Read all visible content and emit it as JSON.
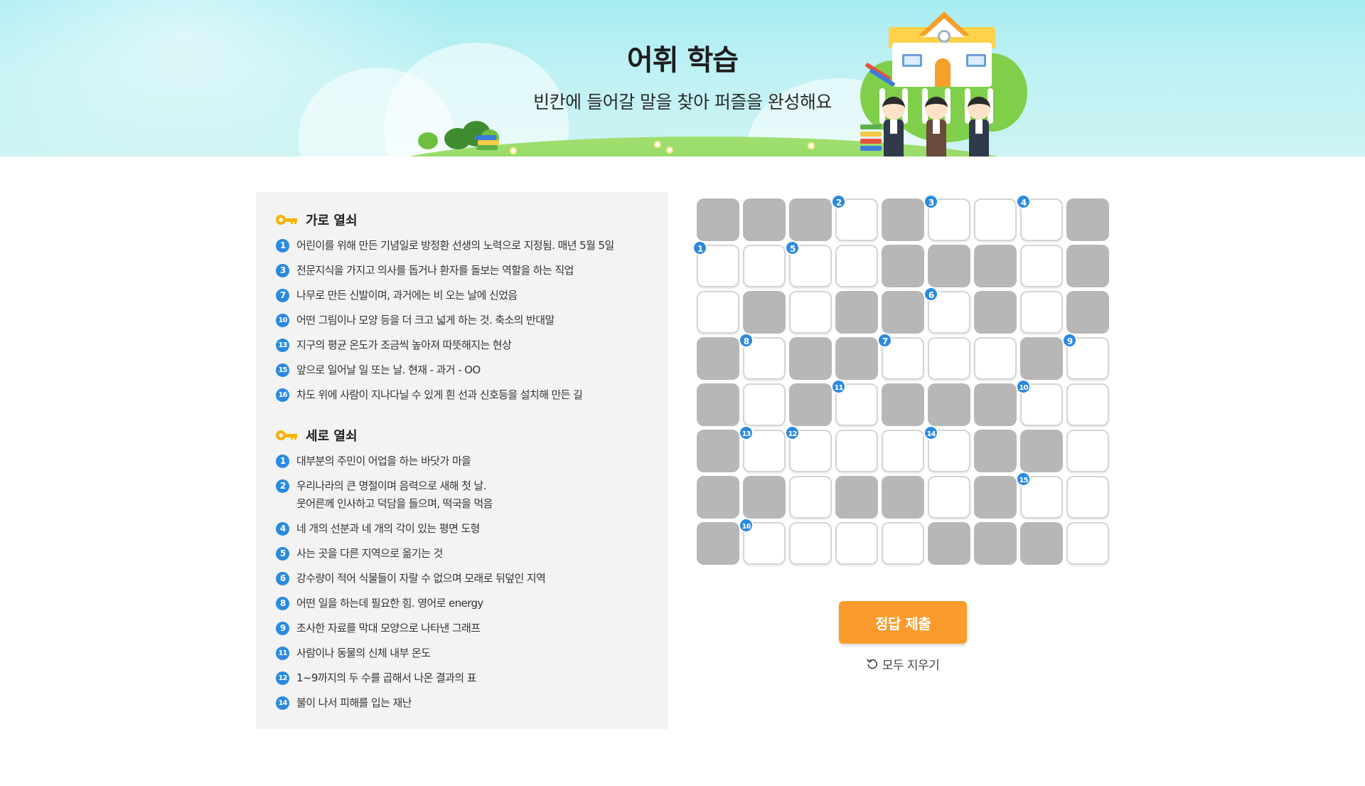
{
  "header": {
    "title": "어휘 학습",
    "subtitle": "빈칸에 들어갈 말을 찾아 퍼즐을 완성해요"
  },
  "clues": {
    "across": {
      "title": "가로 열쇠",
      "items": [
        {
          "num": "1",
          "text": "어린이를 위해 만든 기념일로 방정환 선생의 노력으로 지정됨. 매년 5월 5일"
        },
        {
          "num": "3",
          "text": "전문지식을 가지고 의사를 돕거나 환자를 돌보는 역할을 하는 직업"
        },
        {
          "num": "7",
          "text": "나무로 만든 신발이며, 과거에는 비 오는 날에 신었음"
        },
        {
          "num": "10",
          "text": "어떤 그림이나 모양 등을 더 크고 넓게 하는 것. 축소의 반대말"
        },
        {
          "num": "13",
          "text": "지구의 평균 온도가 조금씩 높아져 따뜻해지는 현상"
        },
        {
          "num": "15",
          "text": "앞으로 일어날 일 또는 날. 현재 - 과거 - OO"
        },
        {
          "num": "16",
          "text": "차도 위에 사람이 지나다닐 수 있게 흰 선과 신호등을 설치해 만든 길"
        }
      ]
    },
    "down": {
      "title": "세로 열쇠",
      "items": [
        {
          "num": "1",
          "text": "대부분의 주민이 어업을 하는 바닷가 마을"
        },
        {
          "num": "2",
          "text": "우리나라의 큰 명절이며 음력으로 새해 첫 날.\n웃어른께 인사하고 덕담을 들으며, 떡국을 먹음"
        },
        {
          "num": "4",
          "text": "네 개의 선분과 네 개의 각이 있는 평면 도형"
        },
        {
          "num": "5",
          "text": "사는 곳을 다른 지역으로 옮기는 것"
        },
        {
          "num": "6",
          "text": "강수량이 적어 식물들이 자랄 수 없으며 모래로 뒤덮인 지역"
        },
        {
          "num": "8",
          "text": "어떤 일을 하는데 필요한 힘. 영어로 energy"
        },
        {
          "num": "9",
          "text": "조사한 자료를 막대 모양으로 나타낸 그래프"
        },
        {
          "num": "11",
          "text": "사람이나 동물의 신체 내부 온도"
        },
        {
          "num": "12",
          "text": "1~9까지의 두 수를 곱해서 나온 결과의 표"
        },
        {
          "num": "14",
          "text": "불이 나서 피해를 입는 재난"
        }
      ]
    }
  },
  "grid": {
    "rows": [
      "BBBWBWWWB",
      "WWWWBBBWB",
      "WBWBBWBWB",
      "BWBBWWWBW",
      "BWBWBBBWW",
      "BWWWWWBBW",
      "BBWBBWBWW",
      "BWWWWBBBW"
    ],
    "numbers": [
      {
        "r": 0,
        "c": 3,
        "n": "2"
      },
      {
        "r": 0,
        "c": 5,
        "n": "3"
      },
      {
        "r": 0,
        "c": 7,
        "n": "4"
      },
      {
        "r": 1,
        "c": 0,
        "n": "1"
      },
      {
        "r": 1,
        "c": 2,
        "n": "5"
      },
      {
        "r": 2,
        "c": 5,
        "n": "6"
      },
      {
        "r": 3,
        "c": 1,
        "n": "8"
      },
      {
        "r": 3,
        "c": 4,
        "n": "7"
      },
      {
        "r": 3,
        "c": 8,
        "n": "9"
      },
      {
        "r": 4,
        "c": 3,
        "n": "11"
      },
      {
        "r": 4,
        "c": 7,
        "n": "10"
      },
      {
        "r": 5,
        "c": 1,
        "n": "13"
      },
      {
        "r": 5,
        "c": 2,
        "n": "12"
      },
      {
        "r": 5,
        "c": 5,
        "n": "14"
      },
      {
        "r": 6,
        "c": 7,
        "n": "15"
      },
      {
        "r": 7,
        "c": 1,
        "n": "16"
      }
    ]
  },
  "actions": {
    "submit_label": "정답 제출",
    "clear_label": "모두 지우기"
  },
  "colors": {
    "accent_blue": "#2a8ae0",
    "submit_orange": "#fb9b2b",
    "blocked_cell": "#b7b7b7",
    "key_gold": "#f4b400"
  }
}
